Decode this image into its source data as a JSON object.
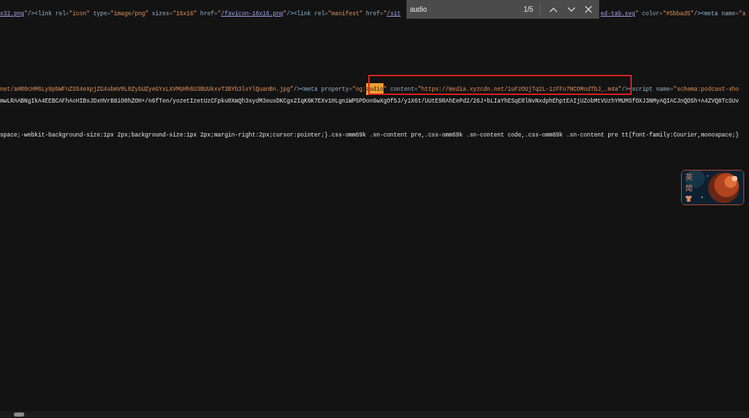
{
  "find_bar": {
    "query": "audio",
    "count": "1/5"
  },
  "source_lines": [
    {
      "segments": [
        [
          {
            "kind": "link",
            "text": "x32.png"
          },
          {
            "kind": "value",
            "text": "\""
          },
          {
            "kind": "tag",
            "text": "/><link "
          },
          {
            "kind": "attr",
            "text": "rel="
          },
          {
            "kind": "value",
            "text": "\"icon\""
          },
          {
            "kind": "attr",
            "text": " type="
          },
          {
            "kind": "value",
            "text": "\"image/png\""
          },
          {
            "kind": "attr",
            "text": " sizes="
          },
          {
            "kind": "value",
            "text": "\"16x16\""
          },
          {
            "kind": "attr",
            "text": " href="
          },
          {
            "kind": "value",
            "text": "\""
          },
          {
            "kind": "link",
            "text": "/favicon-16x16.png"
          },
          {
            "kind": "value",
            "text": "\""
          },
          {
            "kind": "tag",
            "text": "/><link "
          },
          {
            "kind": "attr",
            "text": "rel="
          },
          {
            "kind": "value",
            "text": "\"manifest\""
          },
          {
            "kind": "attr",
            "text": " href="
          },
          {
            "kind": "value",
            "text": "\""
          },
          {
            "kind": "link",
            "text": "/sit"
          }
        ],
        [
          {
            "kind": "link",
            "text": "ed-tab.svg"
          },
          {
            "kind": "value",
            "text": "\""
          },
          {
            "kind": "attr",
            "text": " color="
          },
          {
            "kind": "value",
            "text": "\"#5bbad5\""
          },
          {
            "kind": "tag",
            "text": "/><meta "
          },
          {
            "kind": "attr",
            "text": "name="
          },
          {
            "kind": "value",
            "text": "\"a"
          }
        ]
      ]
    },
    {
      "segments": [
        [
          {
            "kind": "value",
            "text": "net/aHR0cHM6Ly9pbWFnZS54eXpjZG4ubmV0L0ZybUZyeGYxLXVMUHh6U3BUUkxvT3BYb3lsYlQuanBn.jpg\""
          },
          {
            "kind": "tag",
            "text": "/><meta "
          },
          {
            "kind": "attr",
            "text": "property="
          },
          {
            "kind": "value",
            "text": "\"og:"
          },
          {
            "kind": "match",
            "text": "audio"
          },
          {
            "kind": "value",
            "text": "\""
          },
          {
            "kind": "attr",
            "text": " content="
          },
          {
            "kind": "value",
            "text": "\"https://media.xyzcdn.net/1uFzOUjTq2L-1zFFo7NCOModTbJ_.m4a\""
          },
          {
            "kind": "tag",
            "text": "/><script "
          },
          {
            "kind": "attr",
            "text": "name="
          },
          {
            "kind": "value",
            "text": "\"schema:podcast-sho"
          }
        ]
      ]
    },
    {
      "segments": [
        [
          {
            "kind": "text",
            "text": "mwLRAABNgIkA4EEBCAFhAoHIBsJDxHVrB8iO0hZOH+/n6fTen/yozetIzetUzCFpku0XmQh3sydM3eusDKCgx2IqK6K7EXv1HLgniWP5PDon6wXgOf5J/y1X6t/UUtE9RAhEePd2/26J+bLIaYhESqERlNvNxdphEhptEAIjUZobMtVUzhYMUMSfOXJ3NMyAQIACJnQD5h+A4ZVQ8TcSUv"
          }
        ]
      ]
    },
    {
      "segments": [
        [
          {
            "kind": "text",
            "text": "space;-webkit-background-size:1px 2px;background-size:1px 2px;margin-right:2px;cursor:pointer;}.css-omm69k .sn-content pre,.css-omm69k .sn-content code,.css-omm69k .sn-content pre tt{font-family:Courier,monospace;}"
          }
        ]
      ]
    }
  ],
  "floating_widget": {
    "labels": [
      "英",
      "简"
    ]
  }
}
